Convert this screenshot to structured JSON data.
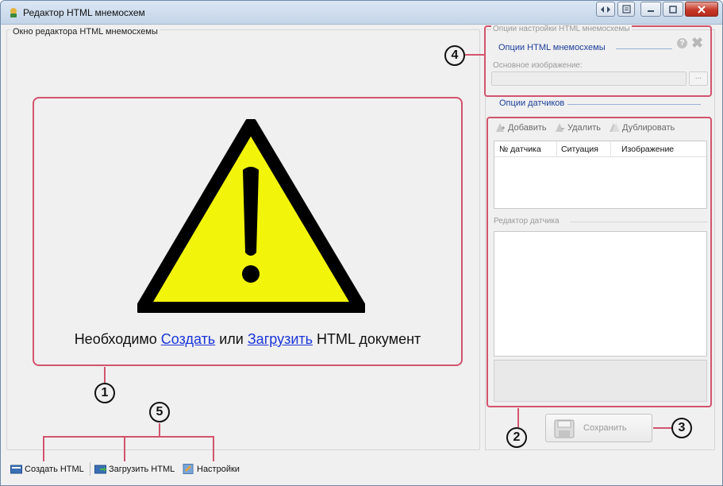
{
  "window": {
    "title": "Редактор HTML мнемосхем"
  },
  "editor": {
    "group_label": "Окно редактора HTML мнемосхемы",
    "message_prefix": "Необходимо ",
    "create_link": "Создать",
    "middle_text": " или ",
    "load_link": "Загрузить",
    "message_suffix": " HTML документ"
  },
  "options": {
    "legend": "Опции настройки HTML мнемосхемы",
    "html_options_title": "Опции HTML мнемосхемы",
    "help_icon_text": "?",
    "close_text": "✖",
    "main_image_label": "Основное изображение:",
    "main_image_value": "",
    "browse_label": "..."
  },
  "sensors": {
    "title": "Опции датчиков",
    "toolbar": {
      "add": "Добавить",
      "delete": "Удалить",
      "duplicate": "Дублировать"
    },
    "columns": [
      "№ датчика",
      "Ситуация",
      "Изображение"
    ],
    "rows": [],
    "editor_label": "Редактор датчика"
  },
  "save": {
    "label": "Сохранить"
  },
  "bottom_toolbar": {
    "create": "Создать HTML",
    "load": "Загрузить HTML",
    "settings": "Настройки"
  },
  "callouts": {
    "c1": "1",
    "c2": "2",
    "c3": "3",
    "c4": "4",
    "c5": "5"
  },
  "colors": {
    "highlight": "#d2546e",
    "link": "#1a36d8",
    "section_title": "#1d3f99",
    "warning_yellow": "#f2f50a"
  }
}
